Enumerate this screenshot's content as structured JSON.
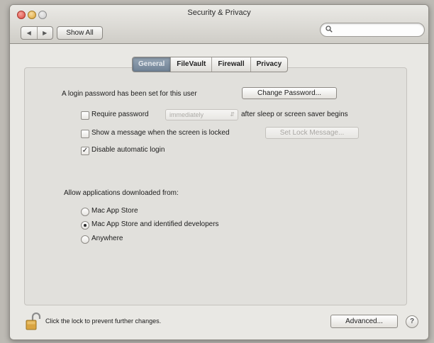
{
  "window": {
    "title": "Security & Privacy"
  },
  "toolbar": {
    "back_icon": "back-arrow-icon",
    "forward_icon": "forward-arrow-icon",
    "show_all_label": "Show All",
    "search_value": "",
    "search_placeholder": ""
  },
  "tabs": [
    {
      "label": "General",
      "active": true
    },
    {
      "label": "FileVault",
      "active": false
    },
    {
      "label": "Firewall",
      "active": false
    },
    {
      "label": "Privacy",
      "active": false
    }
  ],
  "general": {
    "login_text": "A login password has been set for this user",
    "change_password_label": "Change Password...",
    "require_password_label": "Require password",
    "require_password_checked": false,
    "require_password_popup": "immediately",
    "require_password_suffix": "after sleep or screen saver begins",
    "show_message_label": "Show a message when the screen is locked",
    "show_message_checked": false,
    "set_lock_message_label": "Set Lock Message...",
    "disable_autologin_label": "Disable automatic login",
    "disable_autologin_checked": true
  },
  "downloads": {
    "heading": "Allow applications downloaded from:",
    "options": [
      {
        "label": "Mac App Store",
        "selected": false
      },
      {
        "label": "Mac App Store and identified developers",
        "selected": true
      },
      {
        "label": "Anywhere",
        "selected": false
      }
    ]
  },
  "footer": {
    "lock_text": "Click the lock to prevent further changes.",
    "advanced_label": "Advanced...",
    "help_label": "?"
  },
  "colors": {
    "window_bg": "#e9e8e4",
    "pane_bg": "#e1e0dc",
    "tab_active": "#7f90a2",
    "lock_gold": "#d9a441"
  }
}
